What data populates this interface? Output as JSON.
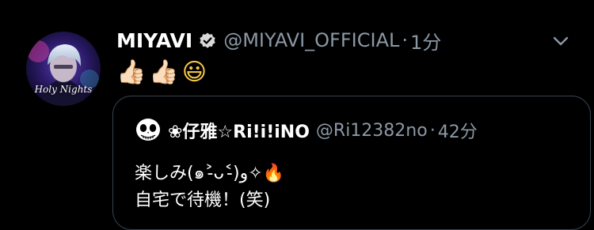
{
  "tweet": {
    "display_name": "MIYAVI",
    "verified_icon": "verified-badge-icon",
    "handle": "@MIYAVI_OFFICIAL",
    "separator": "·",
    "time": "1分",
    "avatar_caption": "Holy Nights",
    "text_emojis": [
      "👍🏻",
      "👍🏻",
      "😃"
    ],
    "menu_icon": "chevron-down-icon"
  },
  "quoted": {
    "display_name": "❀仔雅☆Ri!i!iNO",
    "handle": "@Ri12382no",
    "separator": "·",
    "time": "42分",
    "avatar_icon": "skull-avatar-icon",
    "line1": "楽しみ(๑˃̵ᴗ˂̵)و✧",
    "line1_emoji": "🔥",
    "line2": "自宅で待機！(笑)"
  },
  "colors": {
    "background": "#000000",
    "primary_text": "#ffffff",
    "secondary_text": "#8b98a5",
    "border": "#38444d"
  }
}
